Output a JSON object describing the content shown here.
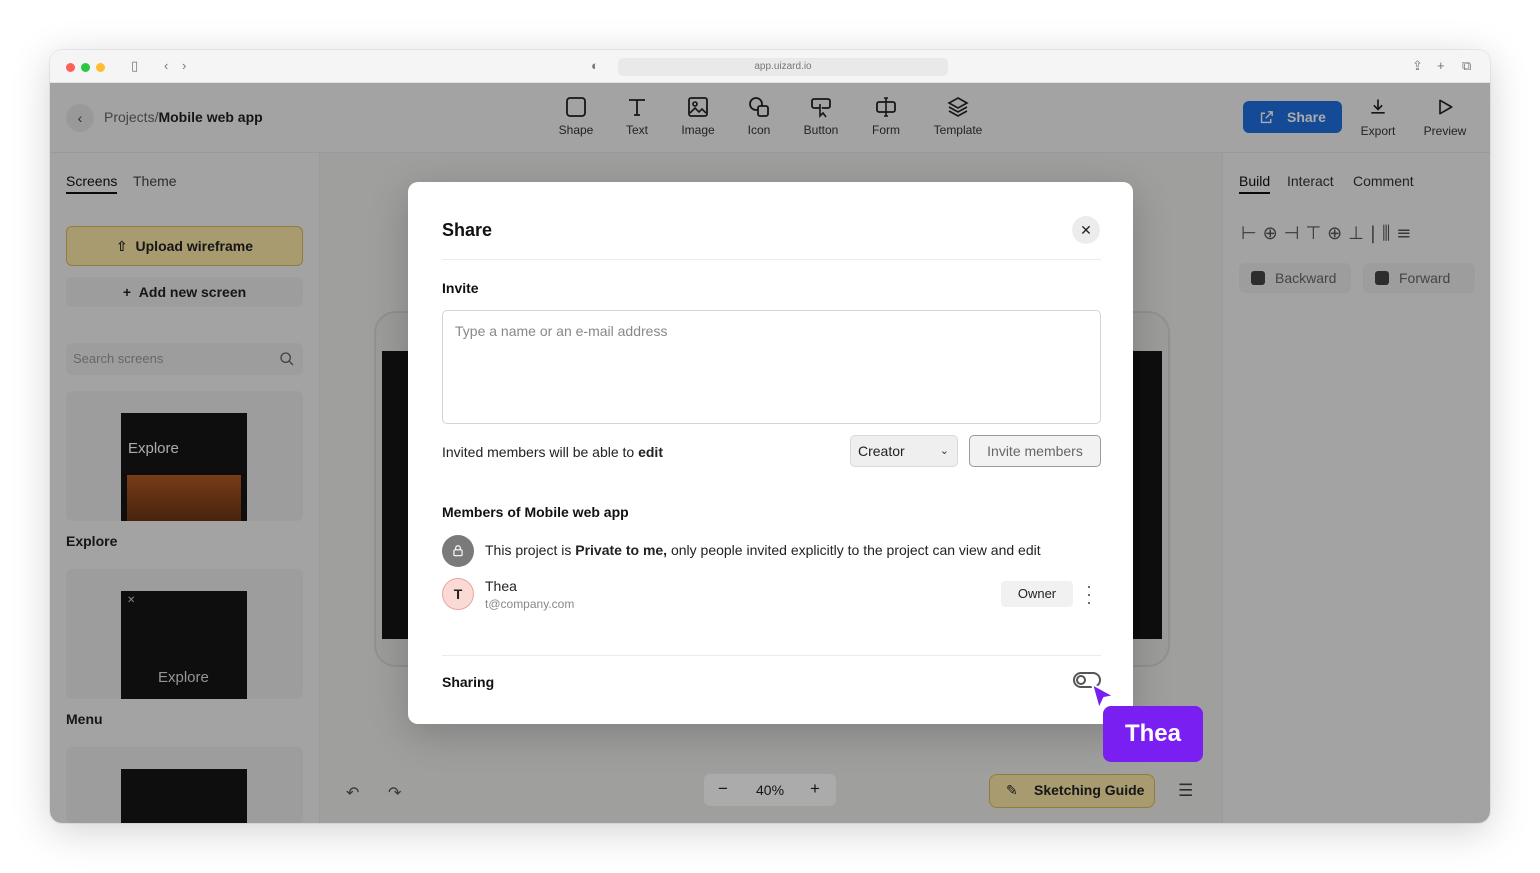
{
  "browser": {
    "url": "app.uizard.io",
    "dot_colors": [
      "#ff5f57",
      "#febc2e",
      "#28c840"
    ]
  },
  "header": {
    "back_icon": "chevron-left-icon",
    "breadcrumb_parent": "Projects",
    "breadcrumb_sep": "/",
    "breadcrumb_current": "Mobile web app",
    "tools": [
      {
        "label": "Shape",
        "icon": "square-icon"
      },
      {
        "label": "Text",
        "icon": "text-t-icon"
      },
      {
        "label": "Image",
        "icon": "image-icon"
      },
      {
        "label": "Icon",
        "icon": "shapes-icon"
      },
      {
        "label": "Button",
        "icon": "pointer-button-icon"
      },
      {
        "label": "Form",
        "icon": "text-field-icon"
      },
      {
        "label": "Template",
        "icon": "layers-icon"
      }
    ],
    "share_label": "Share",
    "export_label": "Export",
    "preview_label": "Preview",
    "accent": "#1f6fe0"
  },
  "left_panel": {
    "tabs": [
      "Screens",
      "Theme"
    ],
    "upload_label": "Upload wireframe",
    "add_screen_label": "Add new screen",
    "search_placeholder": "Search screens",
    "screens": [
      {
        "name": "Explore",
        "thumb_title": "Explore"
      },
      {
        "name": "Menu",
        "thumb_title": "Explore"
      }
    ]
  },
  "right_panel": {
    "tabs": [
      "Build",
      "Interact",
      "Comment"
    ],
    "backward_label": "Backward",
    "forward_label": "Forward"
  },
  "canvas": {
    "zoom": "40%",
    "sketching_guide_label": "Sketching Guide"
  },
  "share_modal": {
    "title": "Share",
    "invite_heading": "Invite",
    "invite_placeholder": "Type a name or an e-mail address",
    "edit_note_prefix": "Invited members will be able to ",
    "edit_note_bold": "edit",
    "role_selected": "Creator",
    "invite_button": "Invite members",
    "members_heading": "Members of Mobile web app",
    "privacy_prefix": "This project is ",
    "privacy_bold": "Private to me,",
    "privacy_suffix": " only people invited explicitly to the project can view and edit",
    "member": {
      "initial": "T",
      "name": "Thea",
      "email": "t@company.com",
      "role": "Owner"
    },
    "sharing_label": "Sharing",
    "sharing_enabled": false
  },
  "cursor": {
    "name": "Thea",
    "color": "#7a1ff2"
  }
}
